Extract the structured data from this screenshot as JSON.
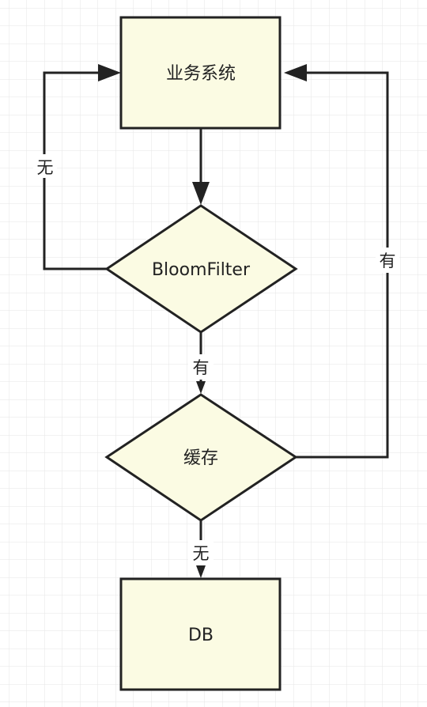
{
  "nodes": {
    "business_system": {
      "label": "业务系统",
      "shape": "rectangle"
    },
    "bloom_filter": {
      "label": "BloomFilter",
      "shape": "diamond"
    },
    "cache": {
      "label": "缓存",
      "shape": "diamond"
    },
    "db": {
      "label": "DB",
      "shape": "rectangle"
    }
  },
  "edges": {
    "business_to_bloom": {
      "from": "业务系统",
      "to": "BloomFilter",
      "label": ""
    },
    "bloom_to_business_none": {
      "from": "BloomFilter",
      "to": "业务系统",
      "label": "无"
    },
    "bloom_to_cache_has": {
      "from": "BloomFilter",
      "to": "缓存",
      "label": "有"
    },
    "cache_to_business_has": {
      "from": "缓存",
      "to": "业务系统",
      "label": "有"
    },
    "cache_to_db_none": {
      "from": "缓存",
      "to": "DB",
      "label": "无"
    }
  },
  "colors": {
    "node_fill": "#fbfbe3",
    "stroke": "#222222",
    "grid": "#e6e6e6",
    "background": "#ffffff"
  }
}
